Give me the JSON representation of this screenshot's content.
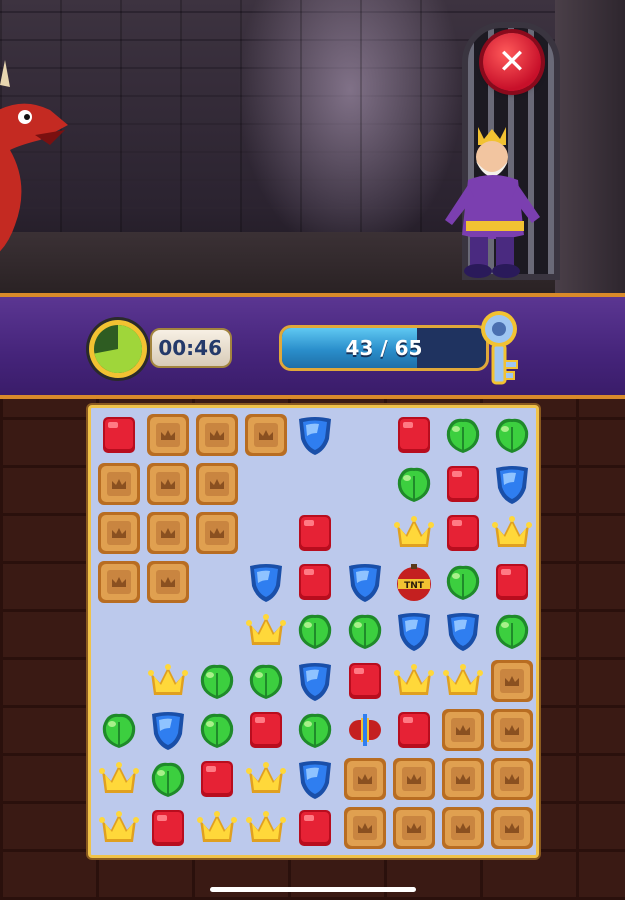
{
  "hud": {
    "timer_text": "00:46",
    "timer_fraction_remaining": 0.72,
    "progress_text": "43 / 65",
    "progress_fraction": 0.66
  },
  "close_button": {
    "icon": "close-x-icon",
    "color": "#c8102a"
  },
  "colors": {
    "hud_purple": "#4a2780",
    "frame_gold": "#f0c34a",
    "board_bg": "#bcc9ec"
  },
  "board": {
    "cols": 9,
    "rows": 9,
    "legend": {
      "R": "red-cube",
      "B": "blue-shield",
      "G": "green-leaf",
      "Y": "yellow-crown",
      "W": "wooden-crate",
      "T": "tnt-bomb",
      "P": "rocket-powerup",
      ".": "empty"
    },
    "grid": [
      "RWWWB.RGG",
      "WWW...GRB",
      "WWW.R.YRY",
      "WW.BRBTGR",
      "...YGGBBG",
      ".YGGBRYYW",
      "GBGRGPRWW",
      "YGRYBWWWW",
      "YRYYRWWWW"
    ]
  }
}
